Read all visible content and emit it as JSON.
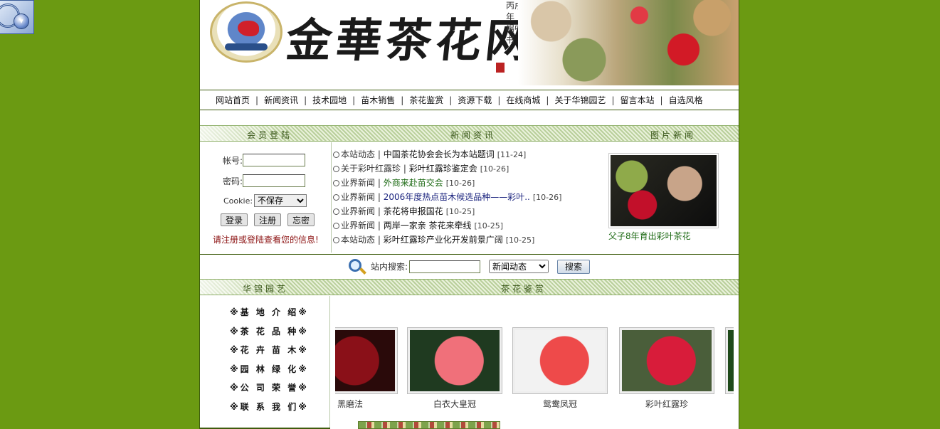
{
  "site": {
    "title_calligraphy": "金華茶花网",
    "calligraphy_signature": "丙戌年 楊中书"
  },
  "nav": {
    "items": [
      "网站首页",
      "新闻资讯",
      "技术园地",
      "苗木销售",
      "茶花鉴赏",
      "资源下载",
      "在线商城",
      "关于华锦园艺",
      "留言本站",
      "自选风格"
    ],
    "separator": "|"
  },
  "section_headers": {
    "login": "会员登陆",
    "news": "新闻资讯",
    "photo_news": "图片新闻",
    "huajin": "华锦园艺",
    "camellia": "茶花鉴赏"
  },
  "login": {
    "account_label": "帐号:",
    "password_label": "密码:",
    "cookie_label": "Cookie:",
    "cookie_value": "不保存",
    "btn_login": "登录",
    "btn_register": "注册",
    "btn_forgot": "忘密",
    "tip": "请注册或登陆查看您的信息!"
  },
  "news": [
    {
      "category": "本站动态",
      "title": "中国茶花协会会长为本站题词",
      "date": "[11-24]",
      "color": "dark"
    },
    {
      "category": "关于彩叶红露珍",
      "title": "彩叶红露珍鉴定会",
      "date": "[10-26]",
      "color": "dark"
    },
    {
      "category": "业界新闻",
      "title": "外商来赴苗交会",
      "date": "[10-26]",
      "color": "green"
    },
    {
      "category": "业界新闻",
      "title": "2006年度热点苗木候选品种——彩叶..",
      "date": "[10-26]",
      "color": "blue"
    },
    {
      "category": "业界新闻",
      "title": "茶花将申报国花",
      "date": "[10-25]",
      "color": "dark"
    },
    {
      "category": "业界新闻",
      "title": "两岸一家亲 茶花来牵线",
      "date": "[10-25]",
      "color": "dark"
    },
    {
      "category": "本站动态",
      "title": "彩叶红露珍产业化开发前景广阔",
      "date": "[10-25]",
      "color": "dark"
    }
  ],
  "photo_news": {
    "caption": "父子8年育出彩叶茶花"
  },
  "search": {
    "label": "站内搜索:",
    "input_value": "",
    "category_value": "新闻动态",
    "button": "搜索"
  },
  "huajin_menu": [
    "※基 地 介 绍※",
    "※茶 花 品 种※",
    "※花 卉 苗 木※",
    "※园 林 绿 化※",
    "※公 司 荣 誉※",
    "※联 系 我 们※"
  ],
  "gallery": [
    {
      "name": "黑磨法",
      "colors": [
        "#8a1018",
        "#2a0a0a"
      ]
    },
    {
      "name": "白衣大皇冠",
      "colors": [
        "#f0707a",
        "#1f3a20"
      ]
    },
    {
      "name": "鸳鸯凤冠",
      "colors": [
        "#ee4a4a",
        "#f2f2f2"
      ]
    },
    {
      "name": "彩叶红露珍",
      "colors": [
        "#d81c3a",
        "#4a5e3a"
      ]
    }
  ],
  "colors": {
    "page_background": "#6b9a12",
    "header_bar_text": "#3d5a1e",
    "tip_red": "#8b1010",
    "link_green": "#1d6a14",
    "link_blue": "#1a237e"
  }
}
